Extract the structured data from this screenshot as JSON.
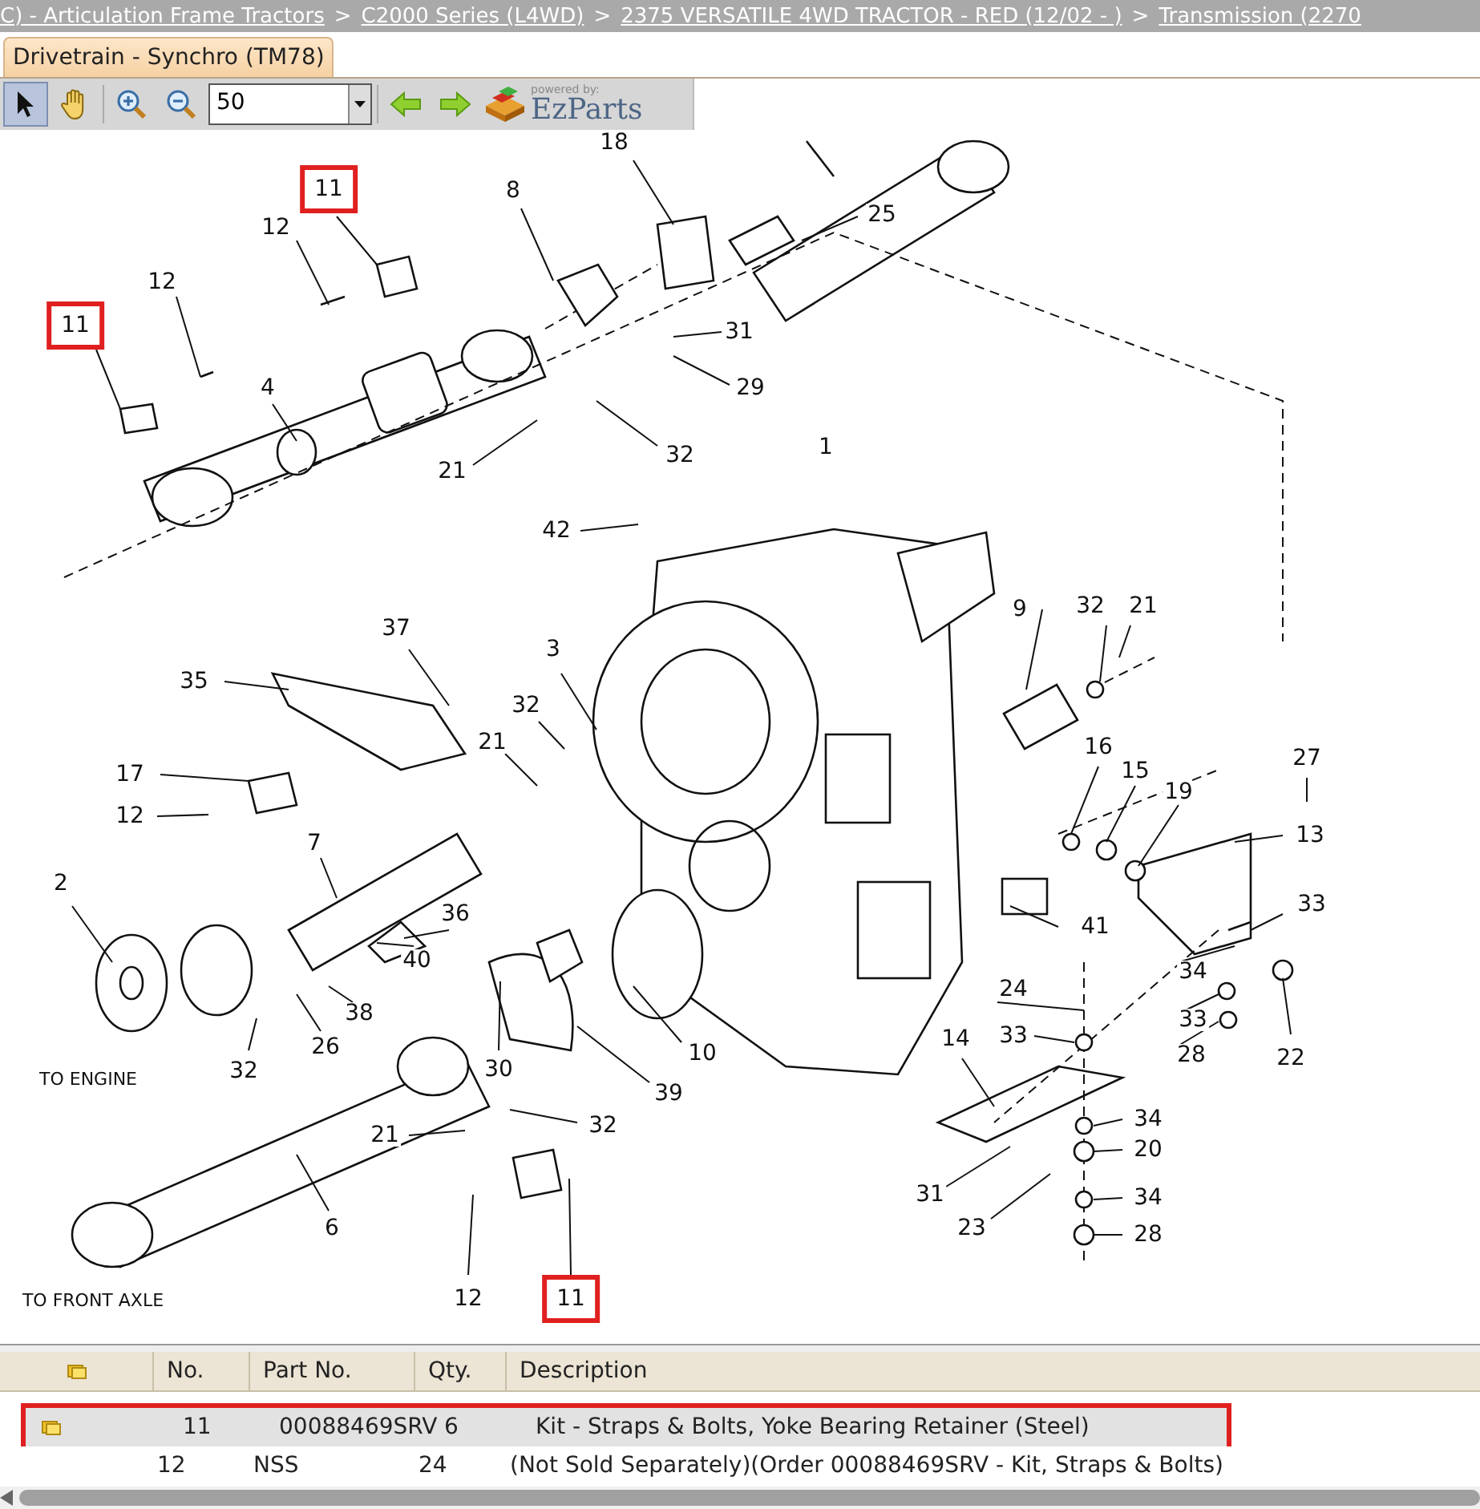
{
  "breadcrumb": [
    {
      "label": "C) - Articulation Frame Tractors"
    },
    {
      "label": "C2000 Series (L4WD)"
    },
    {
      "label": "2375 VERSATILE 4WD TRACTOR - RED (12/02 - )"
    },
    {
      "label": "Transmission (2270"
    }
  ],
  "breadcrumb_separator": ">",
  "tabs": [
    {
      "label": "Drivetrain - Synchro (TM78)",
      "selected": true
    }
  ],
  "toolbar": {
    "tools": [
      {
        "kind": "pointer",
        "selected": true
      },
      {
        "kind": "hand",
        "selected": false
      },
      {
        "kind": "zoom-in",
        "selected": false
      },
      {
        "kind": "zoom-out",
        "selected": false
      }
    ],
    "zoom_value": "50",
    "logo_tagline": "powered by:",
    "logo_name": "EzParts"
  },
  "diagram": {
    "callouts": [
      {
        "label": "18",
        "highlighted": false
      },
      {
        "label": "11",
        "highlighted": true
      },
      {
        "label": "8",
        "highlighted": false
      },
      {
        "label": "25",
        "highlighted": false
      },
      {
        "label": "12",
        "highlighted": false
      },
      {
        "label": "12",
        "highlighted": false
      },
      {
        "label": "11",
        "highlighted": true
      },
      {
        "label": "31",
        "highlighted": false
      },
      {
        "label": "4",
        "highlighted": false
      },
      {
        "label": "29",
        "highlighted": false
      },
      {
        "label": "21",
        "highlighted": false
      },
      {
        "label": "32",
        "highlighted": false
      },
      {
        "label": "1",
        "highlighted": false
      },
      {
        "label": "42",
        "highlighted": false
      },
      {
        "label": "37",
        "highlighted": false
      },
      {
        "label": "9",
        "highlighted": false
      },
      {
        "label": "32",
        "highlighted": false
      },
      {
        "label": "21",
        "highlighted": false
      },
      {
        "label": "3",
        "highlighted": false
      },
      {
        "label": "35",
        "highlighted": false
      },
      {
        "label": "32",
        "highlighted": false
      },
      {
        "label": "21",
        "highlighted": false
      },
      {
        "label": "16",
        "highlighted": false
      },
      {
        "label": "17",
        "highlighted": false
      },
      {
        "label": "15",
        "highlighted": false
      },
      {
        "label": "27",
        "highlighted": false
      },
      {
        "label": "19",
        "highlighted": false
      },
      {
        "label": "12",
        "highlighted": false
      },
      {
        "label": "7",
        "highlighted": false
      },
      {
        "label": "13",
        "highlighted": false
      },
      {
        "label": "2",
        "highlighted": false
      },
      {
        "label": "36",
        "highlighted": false
      },
      {
        "label": "41",
        "highlighted": false
      },
      {
        "label": "33",
        "highlighted": false
      },
      {
        "label": "40",
        "highlighted": false
      },
      {
        "label": "34",
        "highlighted": false
      },
      {
        "label": "24",
        "highlighted": false
      },
      {
        "label": "38",
        "highlighted": false
      },
      {
        "label": "26",
        "highlighted": false
      },
      {
        "label": "10",
        "highlighted": false
      },
      {
        "label": "14",
        "highlighted": false
      },
      {
        "label": "33",
        "highlighted": false
      },
      {
        "label": "33",
        "highlighted": false
      },
      {
        "label": "28",
        "highlighted": false
      },
      {
        "label": "22",
        "highlighted": false
      },
      {
        "label": "32",
        "highlighted": false
      },
      {
        "label": "30",
        "highlighted": false
      },
      {
        "label": "39",
        "highlighted": false
      },
      {
        "label": "21",
        "highlighted": false
      },
      {
        "label": "32",
        "highlighted": false
      },
      {
        "label": "34",
        "highlighted": false
      },
      {
        "label": "20",
        "highlighted": false
      },
      {
        "label": "31",
        "highlighted": false
      },
      {
        "label": "34",
        "highlighted": false
      },
      {
        "label": "6",
        "highlighted": false
      },
      {
        "label": "23",
        "highlighted": false
      },
      {
        "label": "28",
        "highlighted": false
      },
      {
        "label": "12",
        "highlighted": false
      },
      {
        "label": "11",
        "highlighted": true
      }
    ],
    "notes": [
      {
        "label": "TO ENGINE"
      },
      {
        "label": "TO FRONT AXLE"
      }
    ]
  },
  "table": {
    "columns": [
      "No.",
      "Part No.",
      "Qty.",
      "Description"
    ],
    "rows": [
      {
        "no": "11",
        "part_no": "00088469SRV",
        "qty": "6",
        "description": "Kit - Straps & Bolts, Yoke Bearing Retainer (Steel)",
        "selected": true
      },
      {
        "no": "12",
        "part_no": "NSS",
        "qty": "24",
        "description": "(Not Sold Separately)(Order 00088469SRV - Kit, Straps & Bolts)",
        "selected": false
      }
    ]
  }
}
